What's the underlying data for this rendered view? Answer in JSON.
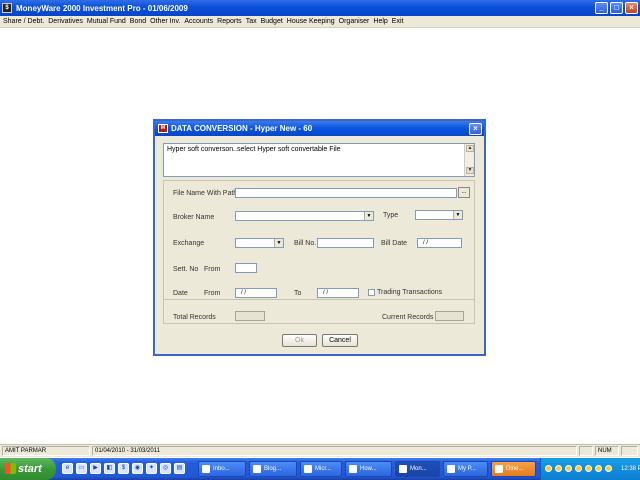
{
  "app": {
    "title": "MoneyWare 2000 Investment Pro - 01/06/2009",
    "icon": "app-icon",
    "window_buttons": {
      "minimize": "_",
      "maximize": "□",
      "close": "×"
    }
  },
  "menu": [
    "Share / Debt.",
    "Derivatives",
    "Mutual Fund",
    "Bond",
    "Other Inv.",
    "Accounts",
    "Reports",
    "Tax",
    "Budget",
    "House Keeping",
    "Organiser",
    "Help",
    "Exit"
  ],
  "dialog": {
    "title": "DATA CONVERSION - Hyper New - 60",
    "info_text": "Hyper soft converson..select Hyper soft convertable File",
    "labels": {
      "file_name": "File Name  With Path",
      "broker_name": "Broker Name",
      "type": "Type",
      "exchange": "Exchange",
      "bill_no": "Bill No.",
      "bill_date": "Bill Date",
      "sett_no": "Sett. No",
      "from": "From",
      "date": "Date",
      "date_from": "From",
      "to": "To",
      "trading_transactions": "Trading Transactions",
      "total_records": "Total Records",
      "current_records": "Current Records"
    },
    "values": {
      "file_name": "",
      "broker_name": "",
      "type": "",
      "exchange": "",
      "bill_no": "",
      "bill_date": "/  /",
      "sett_no_from": "",
      "date_from": "/  /",
      "date_to": "/  /",
      "trading_transactions_checked": false,
      "total_records": "",
      "current_records": ""
    },
    "browse_label": "...",
    "buttons": {
      "ok": "Ok",
      "cancel": "Cancel"
    }
  },
  "statusbar": {
    "user": "AMIT PARMAR",
    "period": "01/04/2010 - 31/03/2011",
    "num": "NUM"
  },
  "taskbar": {
    "start": "start",
    "tasks": [
      "Inbo...",
      "Blog...",
      "Micr...",
      "How...",
      "Mon...",
      "My P...",
      "Dine..."
    ],
    "clock": "12:38 PM"
  }
}
